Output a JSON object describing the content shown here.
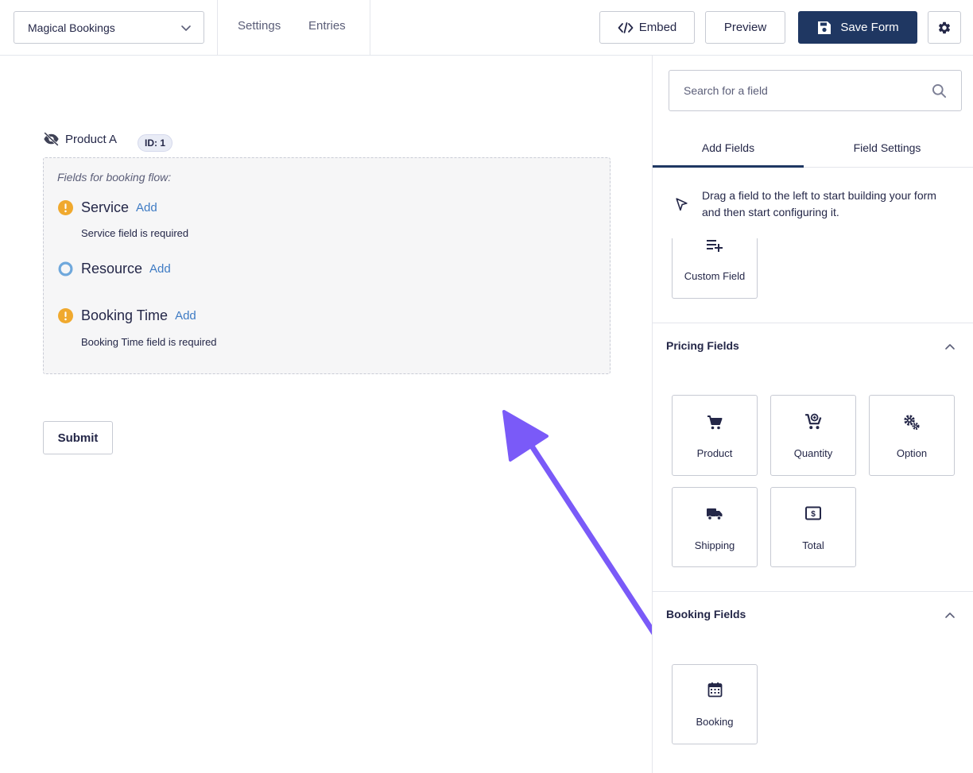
{
  "header": {
    "form_name": "Magical Bookings",
    "nav": {
      "settings": "Settings",
      "entries": "Entries"
    },
    "embed_label": "Embed",
    "preview_label": "Preview",
    "save_label": "Save Form",
    "icons": {
      "form_select": "chevron-down-icon",
      "embed": "code-icon",
      "save": "floppy-disk-icon",
      "settings": "gear-icon"
    }
  },
  "canvas": {
    "field_label": "Product A",
    "field_id": "ID: 1",
    "flow_title": "Fields for booking flow:",
    "flow_items": [
      {
        "name": "Service",
        "add": "Add",
        "status": "warning",
        "error": "Service field is required"
      },
      {
        "name": "Resource",
        "add": "Add",
        "status": "ok",
        "error": ""
      },
      {
        "name": "Booking Time",
        "add": "Add",
        "status": "warning",
        "error": "Booking Time field is required"
      }
    ],
    "submit_label": "Submit",
    "colors": {
      "warning": "#f0a92e",
      "ok_ring": "#6fa8dc",
      "accent_arrow": "#7a5af8"
    }
  },
  "sidebar": {
    "search": {
      "placeholder": "Search for a field"
    },
    "tabs": [
      "Add Fields",
      "Field Settings"
    ],
    "hint": "Drag a field to the left to start building your form and then start configuring it.",
    "custom_field_label": "Custom Field",
    "sections": [
      {
        "title": "Pricing Fields",
        "items": [
          "Product",
          "Quantity",
          "Option",
          "Shipping",
          "Total"
        ]
      },
      {
        "title": "Booking Fields",
        "items": [
          "Booking"
        ]
      }
    ]
  }
}
